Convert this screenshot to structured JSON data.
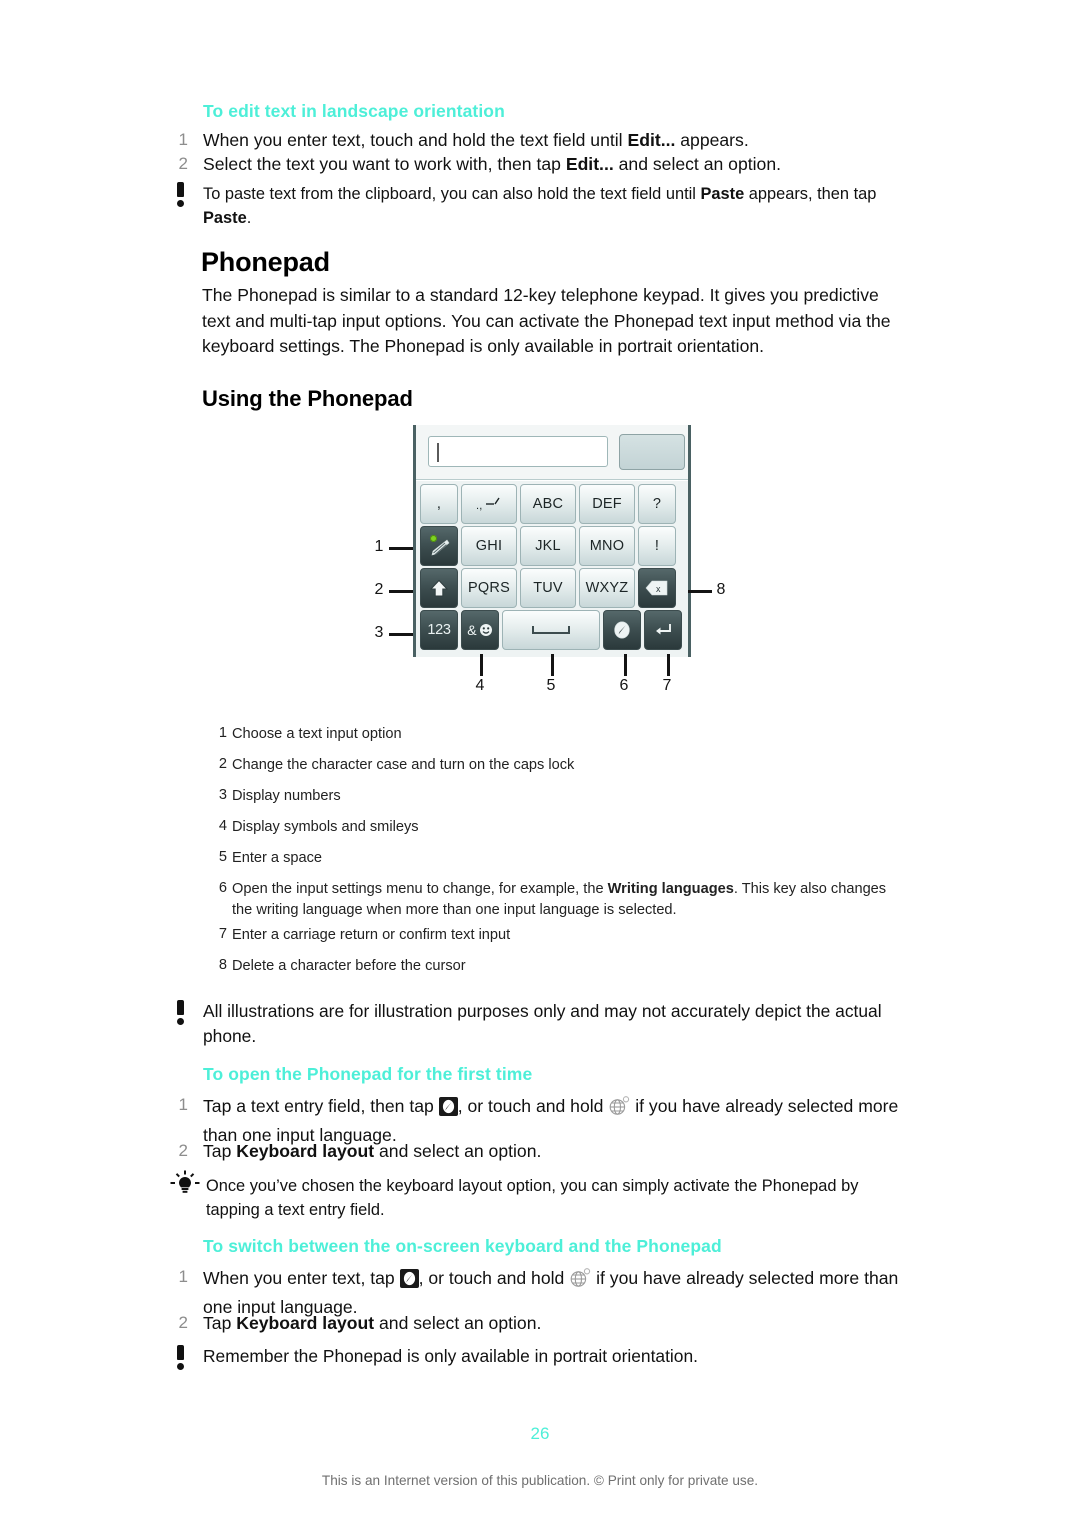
{
  "document": {
    "page_number": "26",
    "footer": "This is an Internet version of this publication. © Print only for private use.",
    "accent_color": "#4defd8"
  },
  "section_landscape": {
    "heading": "To edit text in landscape orientation",
    "steps": [
      {
        "num": "1",
        "text_before": "When you enter text, touch and hold the text field until ",
        "bold": "Edit...",
        "text_after": " appears."
      },
      {
        "num": "2",
        "text_before": "Select the text you want to work with, then tap ",
        "bold": "Edit...",
        "text_after": " and select an option."
      }
    ],
    "note": {
      "icon": "exclamation-icon",
      "text_1": "To paste text from the clipboard, you can also hold the text field until ",
      "bold_1": "Paste",
      "text_2": " appears, then tap ",
      "bold_2": "Paste",
      "text_3": "."
    }
  },
  "section_phonepad": {
    "title": "Phonepad",
    "paragraph": "The Phonepad is similar to a standard 12-key telephone keypad. It gives you predictive text and multi-tap input options. You can activate the Phonepad text input method via the keyboard settings. The Phonepad is only available in portrait orientation.",
    "subtitle": "Using the Phonepad"
  },
  "keyboard": {
    "input_value": "",
    "candidate_label": "",
    "rows": [
      [
        {
          "label": ",",
          "name": "key-comma",
          "style": "light",
          "width": "w-sm"
        },
        {
          "label": ".,-'",
          "name": "key-punctuation",
          "style": "light",
          "width": "w-md"
        },
        {
          "label": "ABC",
          "name": "key-abc",
          "style": "light",
          "width": "w-md"
        },
        {
          "label": "DEF",
          "name": "key-def",
          "style": "light",
          "width": "w-md"
        },
        {
          "label": "?",
          "name": "key-question",
          "style": "light",
          "width": "w-sm"
        }
      ],
      [
        {
          "label": "",
          "name": "key-input-options",
          "style": "dark",
          "width": "w-sm",
          "icon": "pencil-icon"
        },
        {
          "label": "GHI",
          "name": "key-ghi",
          "style": "light",
          "width": "w-md"
        },
        {
          "label": "JKL",
          "name": "key-jkl",
          "style": "light",
          "width": "w-md"
        },
        {
          "label": "MNO",
          "name": "key-mno",
          "style": "light",
          "width": "w-md"
        },
        {
          "label": "!",
          "name": "key-exclamation",
          "style": "light",
          "width": "w-sm"
        }
      ],
      [
        {
          "label": "",
          "name": "key-shift",
          "style": "dark",
          "width": "w-sm",
          "icon": "shift-arrow-icon"
        },
        {
          "label": "PQRS",
          "name": "key-pqrs",
          "style": "light",
          "width": "w-md"
        },
        {
          "label": "TUV",
          "name": "key-tuv",
          "style": "light",
          "width": "w-md"
        },
        {
          "label": "WXYZ",
          "name": "key-wxyz",
          "style": "light",
          "width": "w-md"
        },
        {
          "label": "",
          "name": "key-backspace",
          "style": "dark",
          "width": "w-sm",
          "icon": "backspace-icon"
        }
      ],
      [
        {
          "label": "123",
          "name": "key-numbers",
          "style": "dark",
          "width": "w-sm"
        },
        {
          "label": "&",
          "name": "key-symbols-smileys",
          "style": "dark",
          "width": "w-sm",
          "icon": "smiley-icon"
        },
        {
          "label": "",
          "name": "key-space",
          "style": "light",
          "width": "w-sp",
          "icon": "space-icon"
        },
        {
          "label": "",
          "name": "key-input-settings",
          "style": "dark",
          "width": "w-sm",
          "icon": "settings-pen-icon"
        },
        {
          "label": "",
          "name": "key-enter",
          "style": "dark",
          "width": "w-sm",
          "icon": "enter-arrow-icon"
        }
      ]
    ],
    "callouts": [
      "1",
      "2",
      "3",
      "4",
      "5",
      "6",
      "7",
      "8"
    ]
  },
  "legend": [
    {
      "num": "1",
      "text": "Choose a text input option"
    },
    {
      "num": "2",
      "text": "Change the character case and turn on the caps lock"
    },
    {
      "num": "3",
      "text": "Display numbers"
    },
    {
      "num": "4",
      "text": "Display symbols and smileys"
    },
    {
      "num": "5",
      "text": "Enter a space"
    },
    {
      "num": "6",
      "text_before": "Open the input settings menu to change, for example, the ",
      "bold": "Writing languages",
      "text_after": ". This key also changes the writing language when more than one input language is selected."
    },
    {
      "num": "7",
      "text": "Enter a carriage return or confirm text input"
    },
    {
      "num": "8",
      "text": "Delete a character before the cursor"
    }
  ],
  "illustration_note": {
    "icon": "exclamation-icon",
    "text": "All illustrations are for illustration purposes only and may not accurately depict the actual phone."
  },
  "section_open_first_time": {
    "heading": "To open the Phonepad for the first time",
    "step1": {
      "num": "1",
      "text_1": "Tap a text entry field, then tap ",
      "icon_1": "pen-key-icon",
      "text_2": ", or touch and hold ",
      "icon_2": "globe-icon",
      "text_3": " if you have already selected more than one input language."
    },
    "step2": {
      "num": "2",
      "text_before": "Tap ",
      "bold": "Keyboard layout",
      "text_after": " and select an option."
    },
    "tip": {
      "icon": "lightbulb-icon",
      "text": "Once you’ve chosen the keyboard layout option, you can simply activate the Phonepad by tapping a text entry field."
    }
  },
  "section_switch": {
    "heading": "To switch between the on-screen keyboard and the Phonepad",
    "step1": {
      "num": "1",
      "text_1": "When you enter text, tap ",
      "icon_1": "pen-key-icon",
      "text_2": ", or touch and hold ",
      "icon_2": "globe-icon",
      "text_3": " if you have already selected more than one input language."
    },
    "step2": {
      "num": "2",
      "text_before": "Tap ",
      "bold": "Keyboard layout",
      "text_after": " and select an option."
    },
    "note": {
      "icon": "exclamation-icon",
      "text": "Remember the Phonepad is only available in portrait orientation."
    }
  }
}
